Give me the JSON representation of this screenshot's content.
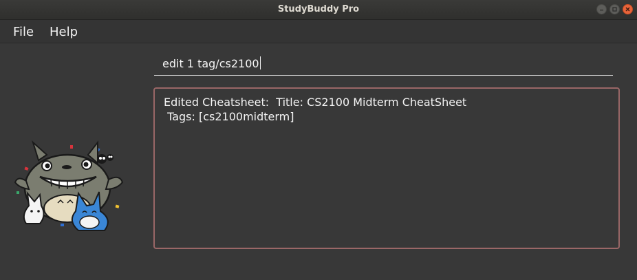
{
  "window": {
    "title": "StudyBuddy Pro"
  },
  "menubar": {
    "items": [
      {
        "label": "File"
      },
      {
        "label": "Help"
      }
    ]
  },
  "command_box": {
    "value": "edit 1 tag/cs2100"
  },
  "result_display": {
    "lines": [
      "Edited Cheatsheet:  Title: CS2100 Midterm CheatSheet",
      " Tags: [cs2100midterm]"
    ]
  },
  "colors": {
    "background": "#383838",
    "result_border": "#9a6767",
    "close_button": "#e9643a",
    "text": "#f4f4f4"
  },
  "icons": {
    "minimize": "minimize-icon",
    "maximize": "maximize-icon",
    "close": "close-icon",
    "mascot": "totoro-mascot-image"
  }
}
